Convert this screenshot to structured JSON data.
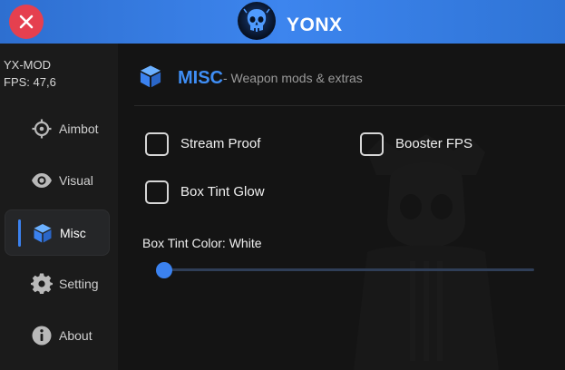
{
  "header": {
    "title": "YONX",
    "close_icon": "close-x-icon",
    "logo_icon": "skull-logo-icon"
  },
  "sidebar": {
    "info": [
      "YX-MOD",
      "FPS: 47,6"
    ],
    "items": [
      {
        "label": "Aimbot",
        "icon": "crosshair-icon",
        "active": false
      },
      {
        "label": "Visual",
        "icon": "eye-icon",
        "active": false
      },
      {
        "label": "Misc",
        "icon": "cube-icon",
        "active": true
      },
      {
        "label": "Setting",
        "icon": "gear-icon",
        "active": false
      },
      {
        "label": "About",
        "icon": "info-icon",
        "active": false
      }
    ]
  },
  "main": {
    "section_title": "MISC",
    "section_subtitle": "- Weapon mods & extras",
    "options": [
      {
        "label": "Stream Proof",
        "checked": false
      },
      {
        "label": "Booster FPS",
        "checked": false
      },
      {
        "label": "Box Tint Glow",
        "checked": false
      }
    ],
    "slider": {
      "label": "Box Tint Color: White",
      "value": 0
    }
  },
  "colors": {
    "accent": "#3b82f0",
    "header_bg": "#3d85ee",
    "close_bg": "#e5404f",
    "sidebar_bg": "#1b1b1b",
    "main_bg": "#141414"
  }
}
